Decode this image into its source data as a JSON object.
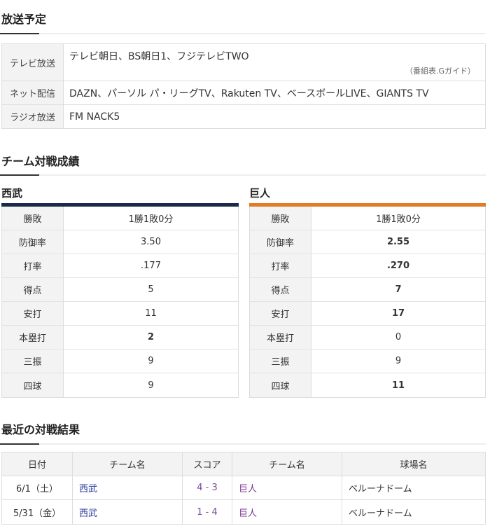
{
  "broadcast": {
    "title": "放送予定",
    "rows": [
      {
        "head": "テレビ放送",
        "value": "テレビ朝日、BS朝日1、フジテレビTWO",
        "source": "（番組表.Gガイド）"
      },
      {
        "head": "ネット配信",
        "value": "DAZN、パーソル パ・リーグTV、Rakuten TV、ベースボールLIVE、GIANTS TV"
      },
      {
        "head": "ラジオ放送",
        "value": "FM NACK5"
      }
    ]
  },
  "stats": {
    "title": "チーム対戦成績",
    "colors": {
      "seibu": "#1b2a4a",
      "kyojin": "#e07b2a"
    },
    "teams": [
      {
        "name": "西武",
        "rows": [
          {
            "head": "勝敗",
            "value": "1勝1敗0分",
            "bold": false
          },
          {
            "head": "防御率",
            "value": "3.50",
            "bold": false
          },
          {
            "head": "打率",
            "value": ".177",
            "bold": false
          },
          {
            "head": "得点",
            "value": "5",
            "bold": false
          },
          {
            "head": "安打",
            "value": "11",
            "bold": false
          },
          {
            "head": "本塁打",
            "value": "2",
            "bold": true
          },
          {
            "head": "三振",
            "value": "9",
            "bold": false
          },
          {
            "head": "四球",
            "value": "9",
            "bold": false
          }
        ]
      },
      {
        "name": "巨人",
        "rows": [
          {
            "head": "勝敗",
            "value": "1勝1敗0分",
            "bold": false
          },
          {
            "head": "防御率",
            "value": "2.55",
            "bold": true
          },
          {
            "head": "打率",
            "value": ".270",
            "bold": true
          },
          {
            "head": "得点",
            "value": "7",
            "bold": true
          },
          {
            "head": "安打",
            "value": "17",
            "bold": true
          },
          {
            "head": "本塁打",
            "value": "0",
            "bold": false
          },
          {
            "head": "三振",
            "value": "9",
            "bold": false
          },
          {
            "head": "四球",
            "value": "11",
            "bold": true
          }
        ]
      }
    ]
  },
  "results": {
    "title": "最近の対戦結果",
    "headers": [
      "日付",
      "チーム名",
      "スコア",
      "チーム名",
      "球場名"
    ],
    "rows": [
      {
        "date": "6/1（土）",
        "home": "西武",
        "score": "4 - 3",
        "away": "巨人",
        "stadium": "ベルーナドーム"
      },
      {
        "date": "5/31（金）",
        "home": "西武",
        "score": "1 - 4",
        "away": "巨人",
        "stadium": "ベルーナドーム"
      }
    ]
  }
}
